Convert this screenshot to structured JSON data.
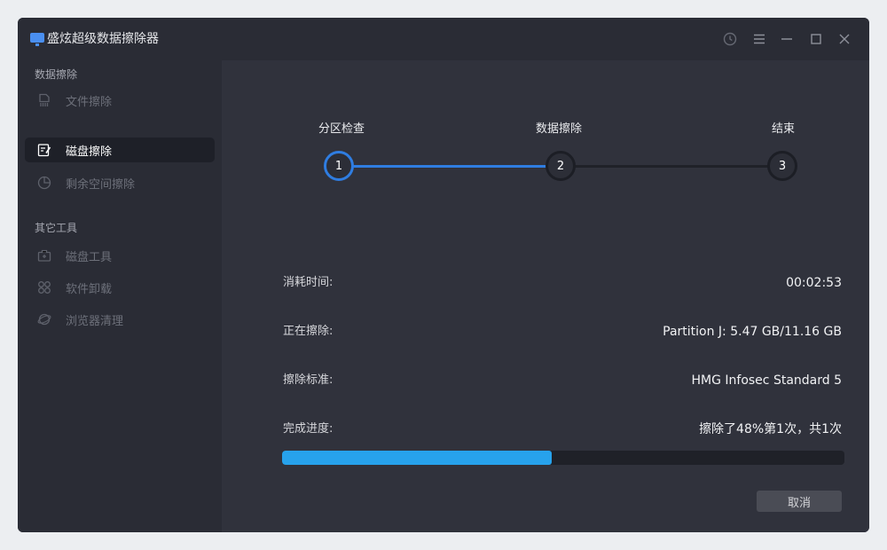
{
  "app": {
    "title": "盛炫超级数据擦除器",
    "icon": "monitor-icon"
  },
  "window_controls": [
    "history-icon",
    "menu-icon",
    "minimize-icon",
    "maximize-icon",
    "close-icon"
  ],
  "sidebar": {
    "groups": [
      {
        "title": "数据擦除",
        "items": [
          {
            "label": "文件擦除",
            "icon": "file-shred-icon",
            "active": false
          },
          {
            "label": "磁盘擦除",
            "icon": "disk-erase-icon",
            "active": true
          },
          {
            "label": "剩余空间擦除",
            "icon": "pie-chart-icon",
            "active": false
          }
        ]
      },
      {
        "title": "其它工具",
        "items": [
          {
            "label": "磁盘工具",
            "icon": "toolbox-icon",
            "active": false
          },
          {
            "label": "软件卸载",
            "icon": "apps-grid-icon",
            "active": false
          },
          {
            "label": "浏览器清理",
            "icon": "browser-icon",
            "active": false
          }
        ]
      }
    ]
  },
  "steps": [
    {
      "label": "分区检查",
      "number": "1"
    },
    {
      "label": "数据擦除",
      "number": "2"
    },
    {
      "label": "结束",
      "number": "3"
    }
  ],
  "info": {
    "elapsed_label": "消耗时间:",
    "elapsed_value": "00:02:53",
    "erasing_label": "正在擦除:",
    "erasing_value": "Partition J: 5.47 GB/11.16 GB",
    "standard_label": "擦除标准:",
    "standard_value": "HMG Infosec Standard 5",
    "progress_label": "完成进度:",
    "progress_value": "擦除了48%第1次，共1次"
  },
  "progress": {
    "percent": 48
  },
  "buttons": {
    "cancel": "取消"
  },
  "colors": {
    "accent": "#2f7de1",
    "progress": "#27a2ec",
    "background": "#30323c",
    "sidebar": "#2a2c35"
  }
}
